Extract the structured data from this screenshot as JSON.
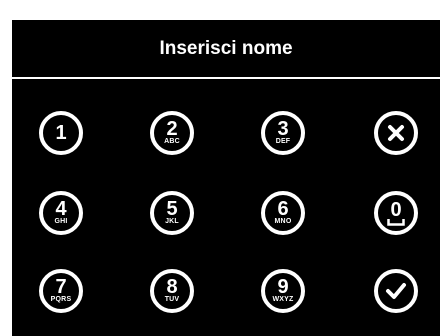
{
  "header": {
    "title": "Inserisci nome"
  },
  "keypad": {
    "keys": [
      {
        "digit": "1",
        "letters": ""
      },
      {
        "digit": "2",
        "letters": "ABC"
      },
      {
        "digit": "3",
        "letters": "DEF"
      },
      {
        "digit": "4",
        "letters": "GHI"
      },
      {
        "digit": "5",
        "letters": "JKL"
      },
      {
        "digit": "6",
        "letters": "MNO"
      },
      {
        "digit": "0",
        "letters": ""
      },
      {
        "digit": "7",
        "letters": "PQRS"
      },
      {
        "digit": "8",
        "letters": "TUV"
      },
      {
        "digit": "9",
        "letters": "WXYZ"
      }
    ],
    "delete_icon": "close-icon",
    "confirm_icon": "check-icon",
    "space_icon": "space-icon"
  },
  "colors": {
    "background": "#000000",
    "foreground": "#ffffff"
  }
}
